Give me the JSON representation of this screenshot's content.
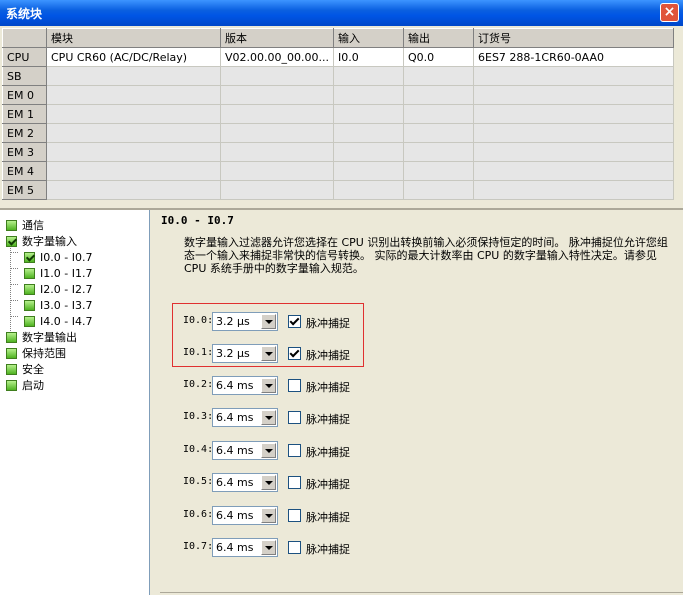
{
  "window": {
    "title": "系统块",
    "close_label": "×"
  },
  "grid": {
    "columns": [
      "",
      "模块",
      "版本",
      "输入",
      "输出",
      "订货号"
    ],
    "rows": [
      {
        "head": "CPU",
        "module": "CPU CR60 (AC/DC/Relay)",
        "version": "V02.00.00_00.00...",
        "input": "I0.0",
        "output": "Q0.0",
        "order": "6ES7 288-1CR60-0AA0"
      },
      {
        "head": "SB",
        "module": "",
        "version": "",
        "input": "",
        "output": "",
        "order": ""
      },
      {
        "head": "EM 0",
        "module": "",
        "version": "",
        "input": "",
        "output": "",
        "order": ""
      },
      {
        "head": "EM 1",
        "module": "",
        "version": "",
        "input": "",
        "output": "",
        "order": ""
      },
      {
        "head": "EM 2",
        "module": "",
        "version": "",
        "input": "",
        "output": "",
        "order": ""
      },
      {
        "head": "EM 3",
        "module": "",
        "version": "",
        "input": "",
        "output": "",
        "order": ""
      },
      {
        "head": "EM 4",
        "module": "",
        "version": "",
        "input": "",
        "output": "",
        "order": ""
      },
      {
        "head": "EM 5",
        "module": "",
        "version": "",
        "input": "",
        "output": "",
        "order": ""
      }
    ]
  },
  "tree": {
    "items": [
      {
        "label": "通信",
        "checked": false,
        "level": 0
      },
      {
        "label": "数字量输入",
        "checked": true,
        "level": 0
      },
      {
        "label": "I0.0 - I0.7",
        "checked": true,
        "level": 1
      },
      {
        "label": "I1.0 - I1.7",
        "checked": false,
        "level": 1
      },
      {
        "label": "I2.0 - I2.7",
        "checked": false,
        "level": 1
      },
      {
        "label": "I3.0 - I3.7",
        "checked": false,
        "level": 1
      },
      {
        "label": "I4.0 - I4.7",
        "checked": false,
        "level": 1
      },
      {
        "label": "数字量输出",
        "checked": false,
        "level": 0
      },
      {
        "label": "保持范围",
        "checked": false,
        "level": 0
      },
      {
        "label": "安全",
        "checked": false,
        "level": 0
      },
      {
        "label": "启动",
        "checked": false,
        "level": 0
      }
    ]
  },
  "content": {
    "title": "I0.0 - I0.7",
    "description": "数字量输入过滤器允许您选择在 CPU 识别出转换前输入必须保持恒定的时间。 脉冲捕捉位允许您组态一个输入来捕捉非常快的信号转换。 实际的最大计数率由 CPU 的数字量输入特性决定。请参见 CPU 系统手册中的数字量输入规范。",
    "pulse_label": "脉冲捕捉",
    "inputs": [
      {
        "label": "I0.0:",
        "filter": "3.2 µs",
        "pulse_capture": true
      },
      {
        "label": "I0.1:",
        "filter": "3.2 µs",
        "pulse_capture": true
      },
      {
        "label": "I0.2:",
        "filter": "6.4 ms",
        "pulse_capture": false
      },
      {
        "label": "I0.3:",
        "filter": "6.4 ms",
        "pulse_capture": false
      },
      {
        "label": "I0.4:",
        "filter": "6.4 ms",
        "pulse_capture": false
      },
      {
        "label": "I0.5:",
        "filter": "6.4 ms",
        "pulse_capture": false
      },
      {
        "label": "I0.6:",
        "filter": "6.4 ms",
        "pulse_capture": false
      },
      {
        "label": "I0.7:",
        "filter": "6.4 ms",
        "pulse_capture": false
      }
    ]
  }
}
